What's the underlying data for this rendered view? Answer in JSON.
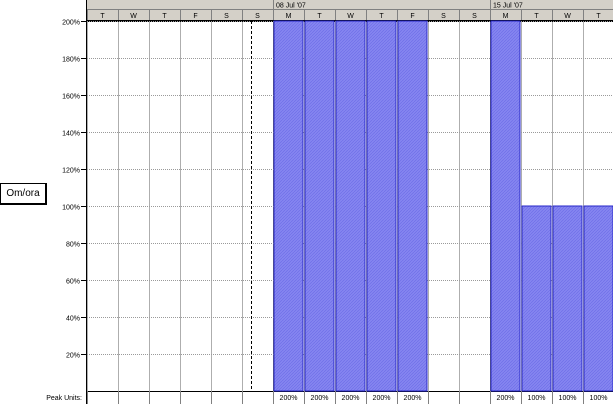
{
  "resource_label": "Om/ora",
  "peak_units_label": "Peak Units:",
  "weeks": [
    {
      "label": "08 Jul '07",
      "start_index": 7
    },
    {
      "label": "15 Jul '07",
      "start_index": 14
    }
  ],
  "day_letters": [
    "T",
    "W",
    "T",
    "F",
    "S",
    "S",
    "M",
    "T",
    "W",
    "T",
    "F",
    "S",
    "S",
    "M",
    "T",
    "W",
    "T"
  ],
  "colors": {
    "bar_fill": "#8585f0",
    "bar_stroke": "#2626c8",
    "header_bg": "#d4d0c8",
    "grid": "#9a9a9a"
  },
  "chart_data": {
    "type": "bar",
    "categories": [
      "T",
      "W",
      "T",
      "F",
      "S",
      "S",
      "M",
      "T",
      "W",
      "T",
      "F",
      "S",
      "S",
      "M",
      "T",
      "W",
      "T"
    ],
    "values": [
      0,
      0,
      0,
      0,
      0,
      0,
      200,
      200,
      200,
      200,
      200,
      0,
      0,
      200,
      100,
      100,
      100
    ],
    "peak_units": [
      "",
      "",
      "",
      "",
      "",
      "",
      "200%",
      "200%",
      "200%",
      "200%",
      "200%",
      "",
      "",
      "200%",
      "100%",
      "100%",
      "100%"
    ],
    "yticks": [
      "20%",
      "40%",
      "60%",
      "80%",
      "100%",
      "120%",
      "140%",
      "160%",
      "180%",
      "200%"
    ],
    "ylim": [
      0,
      200
    ],
    "current_date_index": 5.3
  }
}
